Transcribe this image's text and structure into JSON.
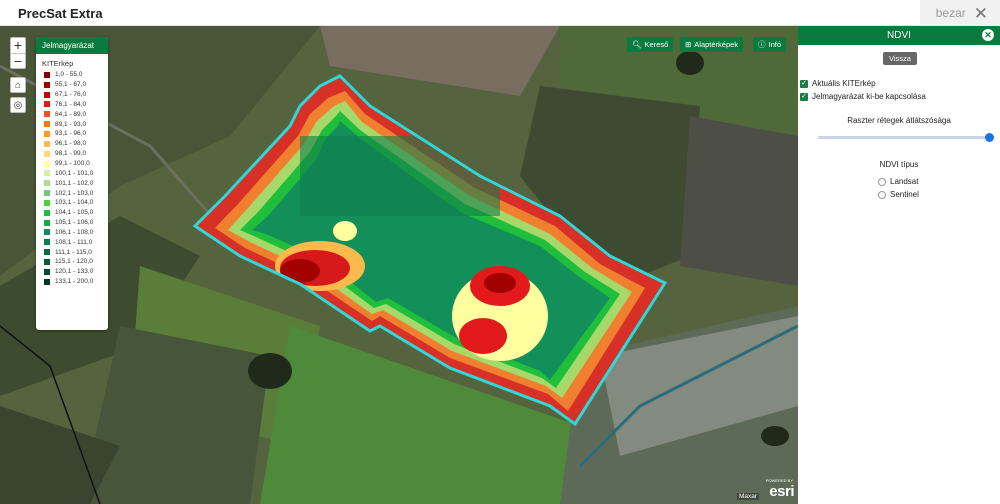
{
  "app": {
    "title": "PrecSat Extra",
    "close_label": "bezar",
    "close_icon": "close-icon"
  },
  "map": {
    "zoom_in": "+",
    "zoom_out": "−",
    "buttons": {
      "search": {
        "label": "Kereső",
        "icon": "search-icon"
      },
      "basemaps": {
        "label": "Alaptérképek",
        "icon": "grid-icon"
      },
      "info": {
        "label": "Infó",
        "icon": "info-icon"
      }
    },
    "attribution": "Maxar",
    "esri_powered": "POWERED BY",
    "esri_logo": "esri"
  },
  "legend": {
    "header": "Jelmagyarázat",
    "title": "KITErkép",
    "items": [
      {
        "label": "1,0 - 55,0",
        "color": "#800000"
      },
      {
        "label": "55,1 - 67,0",
        "color": "#a30000"
      },
      {
        "label": "67,1 - 76,0",
        "color": "#c80000"
      },
      {
        "label": "76,1 - 84,0",
        "color": "#e31a1c"
      },
      {
        "label": "84,1 - 89,0",
        "color": "#f4511e"
      },
      {
        "label": "89,1 - 93,0",
        "color": "#f57c00"
      },
      {
        "label": "93,1 - 96,0",
        "color": "#fb9a29"
      },
      {
        "label": "96,1 - 98,0",
        "color": "#fdb94c"
      },
      {
        "label": "98,1 - 99,0",
        "color": "#fed976"
      },
      {
        "label": "99,1 - 100,0",
        "color": "#ffffa0"
      },
      {
        "label": "100,1 - 101,0",
        "color": "#d9f0a3"
      },
      {
        "label": "101,1 - 102,0",
        "color": "#addd8e"
      },
      {
        "label": "102,1 - 103,0",
        "color": "#78c679"
      },
      {
        "label": "103,1 - 104,0",
        "color": "#4cd137"
      },
      {
        "label": "104,1 - 105,0",
        "color": "#1fbf3c"
      },
      {
        "label": "105,1 - 106,0",
        "color": "#1aa84a"
      },
      {
        "label": "106,1 - 108,0",
        "color": "#138f5a"
      },
      {
        "label": "108,1 - 111,0",
        "color": "#0f7d4d"
      },
      {
        "label": "111,1 - 115,0",
        "color": "#0b6b3f"
      },
      {
        "label": "115,1 - 120,0",
        "color": "#085a35"
      },
      {
        "label": "120,1 - 133,0",
        "color": "#064a2b"
      },
      {
        "label": "133,1 - 200,0",
        "color": "#04391f"
      }
    ]
  },
  "panel": {
    "title": "NDVI",
    "back_label": "Vissza",
    "checkbox_current": "Aktuális KITErkép",
    "checkbox_legend": "Jelmagyarázat ki-be kapcsolása",
    "opacity_label": "Raszter rétegek átlátszósága",
    "opacity_value": 1.0,
    "ndvi_type_label": "NDVI típus",
    "radio_landsat": "Landsat",
    "radio_sentinel": "Sentinel"
  }
}
